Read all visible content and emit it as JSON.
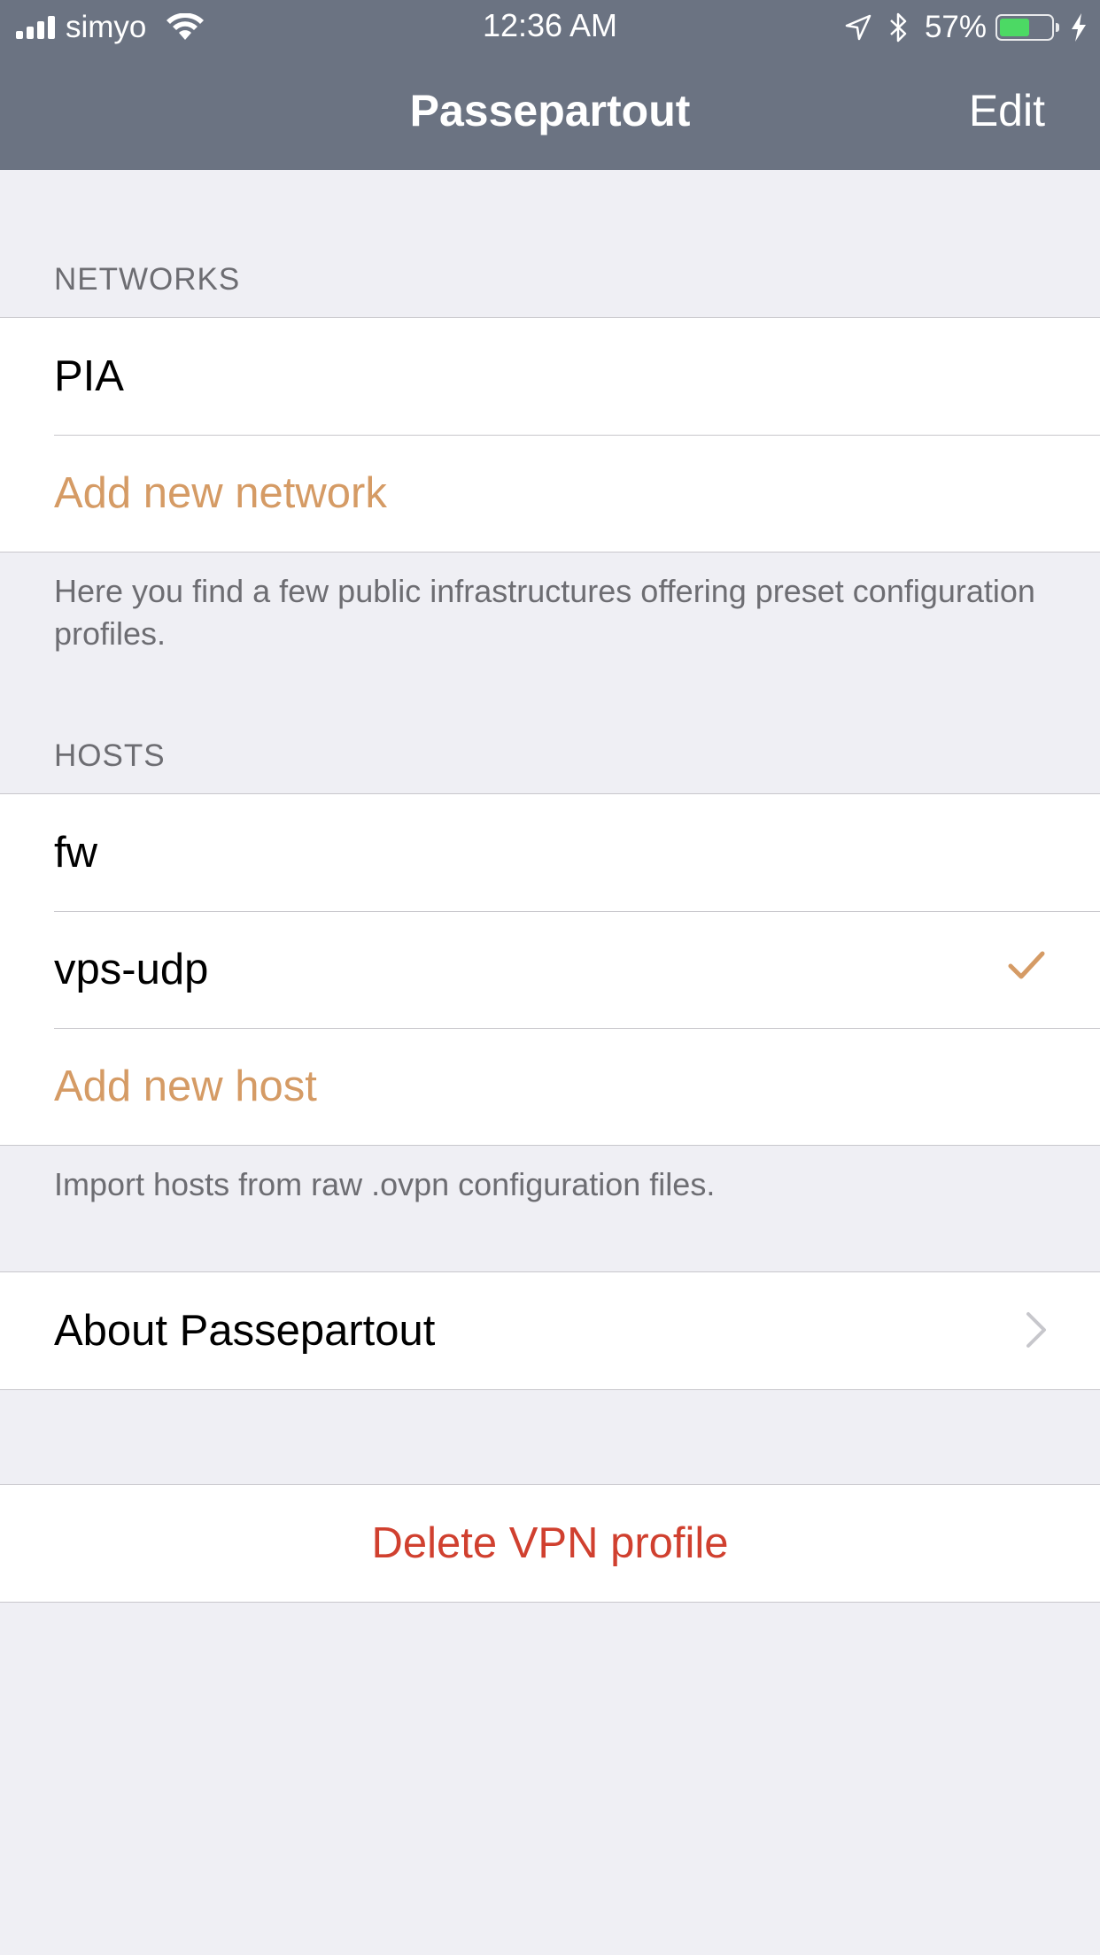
{
  "status_bar": {
    "carrier": "simyo",
    "time": "12:36 AM",
    "battery_percent_text": "57%",
    "battery_level": 0.57,
    "battery_color": "#4cd964"
  },
  "nav": {
    "title": "Passepartout",
    "edit_label": "Edit",
    "bar_color": "#6b7382"
  },
  "networks": {
    "header": "NETWORKS",
    "items": [
      {
        "label": "PIA"
      }
    ],
    "add_label": "Add new network",
    "footer": "Here you find a few public infrastructures offering preset configuration profiles."
  },
  "hosts": {
    "header": "HOSTS",
    "items": [
      {
        "label": "fw",
        "selected": false
      },
      {
        "label": "vps-udp",
        "selected": true
      }
    ],
    "add_label": "Add new host",
    "footer": "Import hosts from raw .ovpn configuration files."
  },
  "about": {
    "label": "About Passepartout"
  },
  "delete": {
    "label": "Delete VPN profile"
  },
  "colors": {
    "accent": "#d59b65",
    "destructive": "#d0402f",
    "background": "#efeff4"
  },
  "icons": [
    "signal-icon",
    "wifi-icon",
    "location-arrow-icon",
    "bluetooth-icon",
    "battery-icon",
    "charging-bolt-icon",
    "checkmark-icon",
    "chevron-right-icon"
  ]
}
